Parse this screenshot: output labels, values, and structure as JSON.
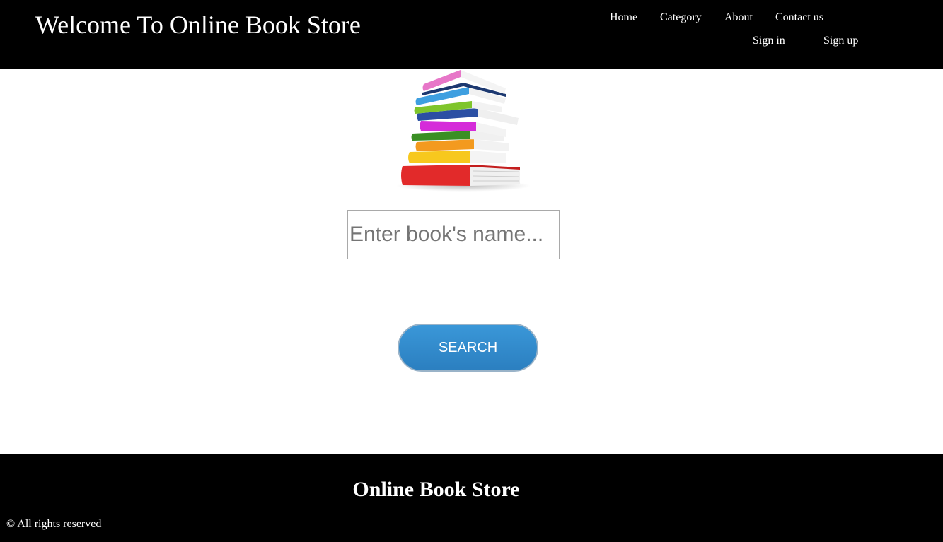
{
  "header": {
    "title": "Welcome To Online Book Store",
    "nav": {
      "home": "Home",
      "category": "Category",
      "about": "About",
      "contact": "Contact us",
      "sign_in": "Sign in",
      "sign_up": "Sign up"
    }
  },
  "main": {
    "image_icon": "stack-of-books",
    "search": {
      "placeholder": "Enter book's name...",
      "value": ""
    },
    "search_button_label": "SEARCH"
  },
  "footer": {
    "title": "Online Book Store",
    "copyright": "© All rights reserved"
  },
  "colors": {
    "header_bg": "#000000",
    "footer_bg": "#000000",
    "button_bg": "#3a97d8",
    "text_light": "#ffffff"
  }
}
